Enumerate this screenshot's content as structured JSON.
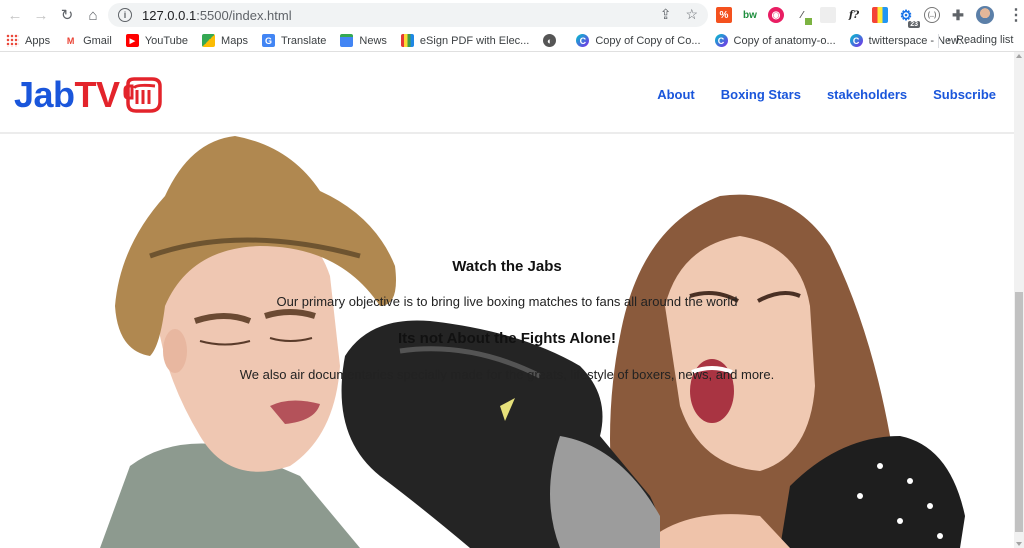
{
  "browser": {
    "url_host": "127.0.0.1",
    "url_rest": ":5500/index.html",
    "bookmarks": [
      {
        "label": "Apps",
        "icon": "apps-grid-icon"
      },
      {
        "label": "Gmail",
        "icon": "gmail-icon"
      },
      {
        "label": "YouTube",
        "icon": "youtube-icon"
      },
      {
        "label": "Maps",
        "icon": "maps-icon"
      },
      {
        "label": "Translate",
        "icon": "translate-icon"
      },
      {
        "label": "News",
        "icon": "news-icon"
      },
      {
        "label": "eSign PDF with Elec...",
        "icon": "esign-icon"
      },
      {
        "label": "",
        "icon": "globe-icon"
      },
      {
        "label": "Copy of Copy of Co...",
        "icon": "canva-icon"
      },
      {
        "label": "Copy of anatomy-o...",
        "icon": "canva-icon"
      },
      {
        "label": "twitterspace - New...",
        "icon": "canva-icon"
      }
    ],
    "reading_list": "Reading list",
    "extension_badge": "23",
    "ext_labels": {
      "bw": "bw",
      "fx": "f?"
    }
  },
  "site": {
    "logo_part1": "Jab",
    "logo_part2": "TV",
    "nav": [
      "About",
      "Boxing Stars",
      "stakeholders",
      "Subscribe"
    ],
    "hero": {
      "heading1": "Watch the Jabs",
      "para1": "Our primary objective is to bring live boxing matches to fans all around the world",
      "heading2": "Its not About the Fights Alone!",
      "para2": "We also air documentaries specially made for the greats, lifestyle of boxers, news, and more."
    }
  },
  "colors": {
    "brand_blue": "#1a56db",
    "brand_red": "#e3242b"
  }
}
